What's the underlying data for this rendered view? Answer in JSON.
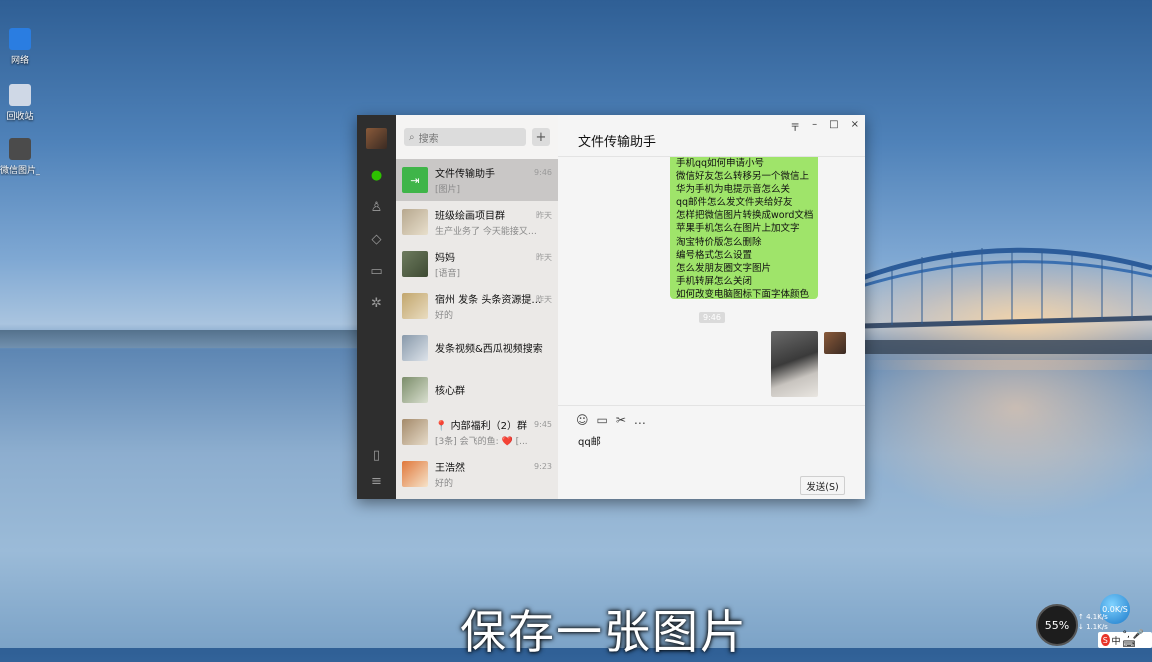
{
  "desktop": {
    "icons": [
      {
        "label": "网络",
        "color": "#2a7de1"
      },
      {
        "label": "回收站",
        "color": "#cfd8e6"
      },
      {
        "label": "微信图片_2020042...",
        "color": "#4b4b4b"
      }
    ],
    "caption": "保存一张图片"
  },
  "wechat": {
    "search_placeholder": "搜索",
    "add_label": "+",
    "chat_title": "文件传输助手",
    "window_controls": {
      "pin": "〒",
      "minimize": "–",
      "maximize": "□",
      "close": "×"
    },
    "conversations": [
      {
        "name": "文件传输助手",
        "msg": "[图片]",
        "time": "9:46",
        "thumb": "#3fb549",
        "active": true
      },
      {
        "name": "班级绘画项目群",
        "msg": "生产业务了 今天能接又…",
        "time": "昨天",
        "thumb": "#b7a88f",
        "active": false
      },
      {
        "name": "妈妈",
        "msg": "[语音]",
        "time": "昨天",
        "thumb": "#6d7b5e",
        "active": false
      },
      {
        "name": "宿州 发条 头条资源提…",
        "msg": "好的",
        "time": "昨天",
        "thumb": "#c2a66d",
        "active": false
      },
      {
        "name": "发条视频&西瓜视频搜索",
        "msg": "",
        "time": "",
        "thumb": "#8899aa",
        "active": false
      },
      {
        "name": "核心群",
        "msg": "",
        "time": "",
        "thumb": "#7b8d6a",
        "active": false
      },
      {
        "name": "📍 内部福利（2）群",
        "msg": "[3条] 会飞的鱼: ❤️ [...",
        "time": "9:45",
        "thumb": "#a48a6a",
        "active": false
      },
      {
        "name": "王浩然",
        "msg": "好的",
        "time": "9:23",
        "thumb": "#e0773a",
        "active": false
      }
    ],
    "bubble_lines": [
      "手机qq如何申请小号",
      "微信好友怎么转移另一个微信上",
      "华为手机为电提示音怎么关",
      "qq邮件怎么发文件夹给好友",
      "怎样把微信图片转换成word文档",
      "苹果手机怎么在图片上加文字",
      "淘宝特价版怎么删除",
      "编号格式怎么设置",
      "怎么发朋友圈文字图片",
      "手机转屏怎么关闭",
      "如何改变电脑图标下面字体颜色"
    ],
    "system_msg": "9:46",
    "typed_text": "qq邮",
    "send_label": "发送(S)"
  },
  "tray": {
    "gauge": "55%",
    "net_ball": "0.0K/S",
    "net_up": "↑ 4.1K/s",
    "net_down": "↓ 1.1K/s",
    "ime_logo": "S",
    "ime_lang": "中",
    "ime_symbols": "°, 🎤 ⌨"
  }
}
